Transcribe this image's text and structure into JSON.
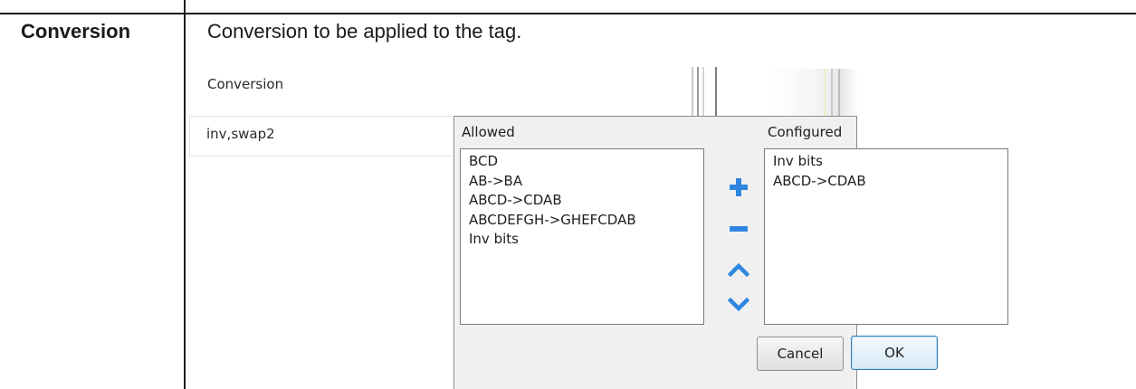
{
  "row": {
    "label": "Conversion",
    "description": "Conversion to be applied to the tag."
  },
  "screenshot": {
    "field_caption": "Conversion",
    "field_value": "inv,swap2",
    "dialog": {
      "allowed_label": "Allowed",
      "configured_label": "Configured",
      "allowed_items": [
        "BCD",
        "AB->BA",
        "ABCD->CDAB",
        "ABCDEFGH->GHEFCDAB",
        "Inv bits"
      ],
      "configured_items": [
        "Inv bits",
        "ABCD->CDAB"
      ],
      "cancel_label": "Cancel",
      "ok_label": "OK"
    }
  },
  "icons": {
    "add": "plus-icon",
    "remove": "minus-icon",
    "move_up": "chevron-up-icon",
    "move_down": "chevron-down-icon"
  },
  "colors": {
    "rule": "#1e1e1e",
    "tool_blue": "#2f86e0",
    "dialog_bg": "#f0f0f0",
    "ok_border": "#3c7fb1"
  }
}
